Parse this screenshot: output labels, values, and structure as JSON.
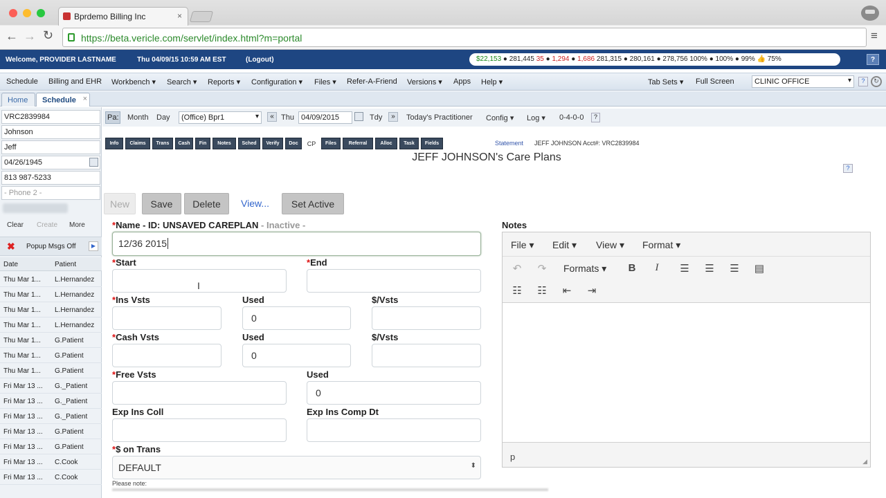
{
  "browser": {
    "tab_title": "Bprdemo Billing Inc",
    "url": "https://beta.vericle.com/servlet/index.html?m=portal"
  },
  "topbar": {
    "welcome": "Welcome, PROVIDER LASTNAME",
    "datetime": "Thu 04/09/15 10:59 AM EST",
    "logout": "(Logout)",
    "ticker": {
      "v1": "$22,153",
      "v2": "281,445",
      "v3": "35",
      "v4": "1,294",
      "v5": "1,686",
      "v6": "281,315",
      "v7": "280,161",
      "v8": "278,756",
      "v9": "100%",
      "v10": "100%",
      "v11": "99%",
      "v12": "75%"
    },
    "help_icon": "?"
  },
  "menu": {
    "items": [
      "Schedule",
      "Billing and EHR",
      "Workbench ▾",
      "Search ▾",
      "Reports ▾",
      "Configuration ▾",
      "Files ▾",
      "Refer-A-Friend",
      "Versions ▾",
      "Apps",
      "Help ▾"
    ],
    "tab_sets": "Tab Sets ▾",
    "full_screen": "Full Screen",
    "office_select": "CLINIC OFFICE"
  },
  "tabs": {
    "home": "Home",
    "schedule": "Schedule",
    "close": "×"
  },
  "patient": {
    "id": "VRC2839984",
    "last_name": "Johnson",
    "first_name": "Jeff",
    "dob": "04/26/1945",
    "phone": "813 987-5233",
    "phone2_placeholder": "- Phone 2 -",
    "clear": "Clear",
    "create": "Create",
    "more": "More",
    "popup": "Popup Msgs Off",
    "col_date": "Date",
    "col_patient": "Patient",
    "appointments": [
      {
        "date": "Thu Mar 1...",
        "patient": "L.Hernandez"
      },
      {
        "date": "Thu Mar 1...",
        "patient": "L.Hernandez"
      },
      {
        "date": "Thu Mar 1...",
        "patient": "L.Hernandez"
      },
      {
        "date": "Thu Mar 1...",
        "patient": "L.Hernandez"
      },
      {
        "date": "Thu Mar 1...",
        "patient": "G.Patient"
      },
      {
        "date": "Thu Mar 1...",
        "patient": "G.Patient"
      },
      {
        "date": "Thu Mar 1...",
        "patient": "G.Patient"
      },
      {
        "date": "Fri Mar 13 ...",
        "patient": "G._Patient"
      },
      {
        "date": "Fri Mar 13 ...",
        "patient": "G._Patient"
      },
      {
        "date": "Fri Mar 13 ...",
        "patient": "G._Patient"
      },
      {
        "date": "Fri Mar 13 ...",
        "patient": "G.Patient"
      },
      {
        "date": "Fri Mar 13 ...",
        "patient": "G.Patient"
      },
      {
        "date": "Fri Mar 13 ...",
        "patient": "C.Cook"
      },
      {
        "date": "Fri Mar 13 ...",
        "patient": "C.Cook"
      }
    ]
  },
  "subbar": {
    "pa": "Pa:",
    "month": "Month",
    "day": "Day",
    "office": "(Office) Bpr1",
    "prev": "«",
    "dow": "Thu",
    "date": "04/09/2015",
    "today": "Tdy",
    "next": "»",
    "practitioner": "Today's Practitioner",
    "config": "Config ▾",
    "log": "Log ▾",
    "code": "0-4-0-0",
    "help": "?"
  },
  "icon_buttons": [
    "Info",
    "Claims",
    "Trans",
    "Cash",
    "Fin",
    "Notes",
    "Sched",
    "Verify",
    "Doc",
    "CP",
    "Files",
    "Referral",
    "Alloc",
    "Task",
    "Fields"
  ],
  "statement_link": "Statement",
  "account_info": "JEFF JOHNSON Acct#: VRC2839984",
  "page_title": "JEFF JOHNSON's Care Plans",
  "actions": {
    "new": "New",
    "save": "Save",
    "delete": "Delete",
    "view": "View...",
    "set_active": "Set Active"
  },
  "form": {
    "name_label": "Name - ID: UNSAVED CAREPLAN",
    "inactive": "- Inactive -",
    "name_value": "12/36 2015",
    "start_label": "Start",
    "end_label": "End",
    "ins_vsts_label": "Ins Vsts",
    "ins_used_label": "Used",
    "ins_used_value": "0",
    "ins_svsts_label": "$/Vsts",
    "cash_vsts_label": "Cash Vsts",
    "cash_used_label": "Used",
    "cash_used_value": "0",
    "cash_svsts_label": "$/Vsts",
    "free_vsts_label": "Free Vsts",
    "free_used_label": "Used",
    "free_used_value": "0",
    "exp_ins_coll_label": "Exp Ins Coll",
    "exp_ins_comp_label": "Exp Ins Comp Dt",
    "trans_label": "$ on Trans",
    "trans_value": "DEFAULT",
    "note_label": "Please note:"
  },
  "notes": {
    "label": "Notes",
    "menu_file": "File ▾",
    "menu_edit": "Edit ▾",
    "menu_view": "View ▾",
    "menu_format": "Format ▾",
    "formats": "Formats ▾",
    "status_path": "p"
  }
}
